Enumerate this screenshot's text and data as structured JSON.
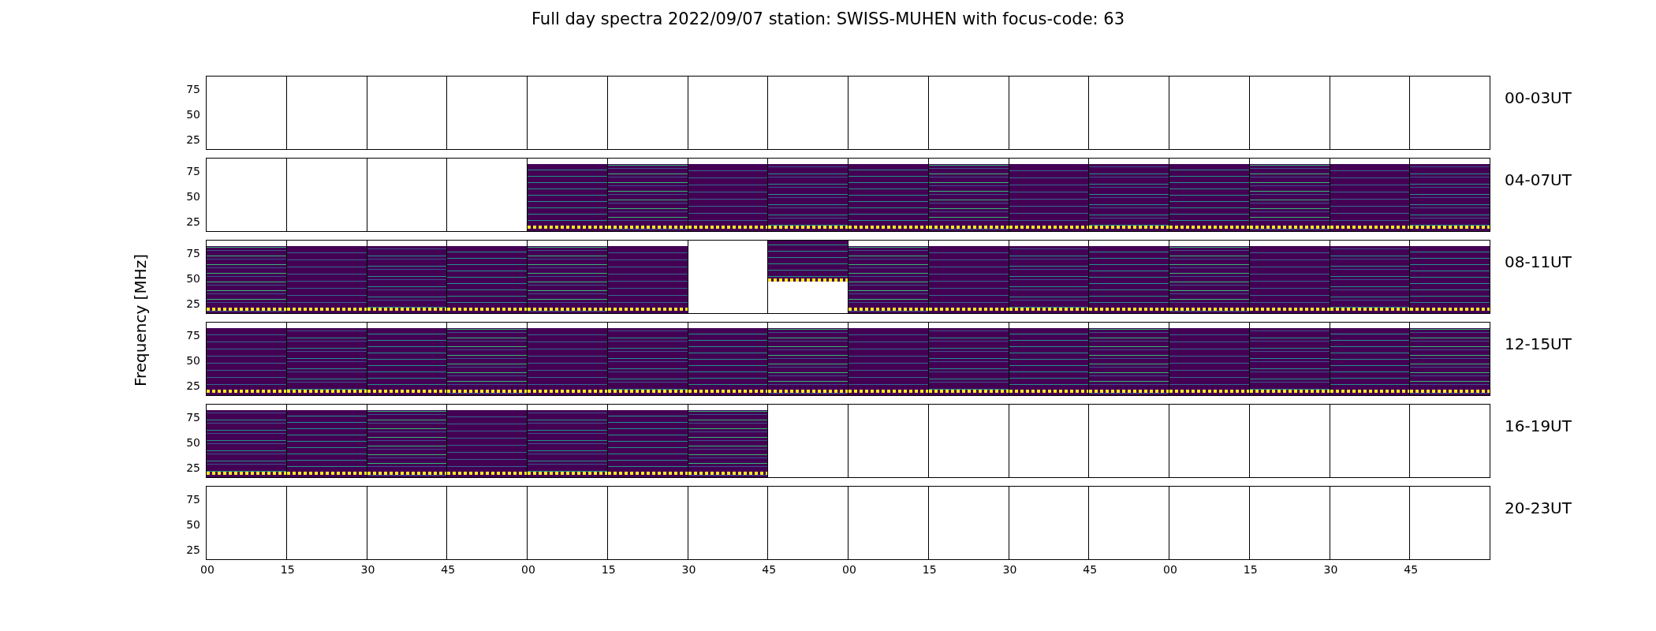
{
  "title": "Full day spectra 2022/09/07 station: SWISS-MUHEN with focus-code: 63",
  "ylabel": "Frequency [MHz]",
  "rows": [
    {
      "label": "00-03UT",
      "y_ticks": [
        "75",
        "50",
        "25"
      ],
      "panels": [
        {
          "kind": "empty"
        },
        {
          "kind": "empty"
        },
        {
          "kind": "empty"
        },
        {
          "kind": "empty"
        },
        {
          "kind": "empty"
        },
        {
          "kind": "empty"
        },
        {
          "kind": "empty"
        },
        {
          "kind": "empty"
        },
        {
          "kind": "empty"
        },
        {
          "kind": "empty"
        },
        {
          "kind": "empty"
        },
        {
          "kind": "empty"
        },
        {
          "kind": "empty"
        },
        {
          "kind": "empty"
        },
        {
          "kind": "empty"
        },
        {
          "kind": "empty"
        }
      ]
    },
    {
      "label": "04-07UT",
      "y_ticks": [
        "75",
        "50",
        "25"
      ],
      "panels": [
        {
          "kind": "empty"
        },
        {
          "kind": "empty"
        },
        {
          "kind": "empty"
        },
        {
          "kind": "empty"
        },
        {
          "kind": "full"
        },
        {
          "kind": "full"
        },
        {
          "kind": "full"
        },
        {
          "kind": "full"
        },
        {
          "kind": "full"
        },
        {
          "kind": "full"
        },
        {
          "kind": "full"
        },
        {
          "kind": "full"
        },
        {
          "kind": "full"
        },
        {
          "kind": "full"
        },
        {
          "kind": "full"
        },
        {
          "kind": "full"
        }
      ]
    },
    {
      "label": "08-11UT",
      "y_ticks": [
        "75",
        "50",
        "25"
      ],
      "panels": [
        {
          "kind": "full"
        },
        {
          "kind": "full"
        },
        {
          "kind": "full"
        },
        {
          "kind": "full"
        },
        {
          "kind": "full"
        },
        {
          "kind": "full"
        },
        {
          "kind": "empty"
        },
        {
          "kind": "partial"
        },
        {
          "kind": "full"
        },
        {
          "kind": "full"
        },
        {
          "kind": "full"
        },
        {
          "kind": "full"
        },
        {
          "kind": "full"
        },
        {
          "kind": "full"
        },
        {
          "kind": "full"
        },
        {
          "kind": "full"
        }
      ]
    },
    {
      "label": "12-15UT",
      "y_ticks": [
        "75",
        "50",
        "25"
      ],
      "panels": [
        {
          "kind": "full"
        },
        {
          "kind": "full"
        },
        {
          "kind": "full"
        },
        {
          "kind": "full"
        },
        {
          "kind": "full"
        },
        {
          "kind": "full"
        },
        {
          "kind": "full"
        },
        {
          "kind": "full"
        },
        {
          "kind": "full"
        },
        {
          "kind": "full"
        },
        {
          "kind": "full"
        },
        {
          "kind": "full"
        },
        {
          "kind": "full"
        },
        {
          "kind": "full"
        },
        {
          "kind": "full"
        },
        {
          "kind": "full"
        }
      ]
    },
    {
      "label": "16-19UT",
      "y_ticks": [
        "75",
        "50",
        "25"
      ],
      "panels": [
        {
          "kind": "full"
        },
        {
          "kind": "full"
        },
        {
          "kind": "full"
        },
        {
          "kind": "full"
        },
        {
          "kind": "full"
        },
        {
          "kind": "full"
        },
        {
          "kind": "full"
        },
        {
          "kind": "empty"
        },
        {
          "kind": "empty"
        },
        {
          "kind": "empty"
        },
        {
          "kind": "empty"
        },
        {
          "kind": "empty"
        },
        {
          "kind": "empty"
        },
        {
          "kind": "empty"
        },
        {
          "kind": "empty"
        },
        {
          "kind": "empty"
        }
      ]
    },
    {
      "label": "20-23UT",
      "y_ticks": [
        "75",
        "50",
        "25"
      ],
      "panels": [
        {
          "kind": "empty"
        },
        {
          "kind": "empty"
        },
        {
          "kind": "empty"
        },
        {
          "kind": "empty"
        },
        {
          "kind": "empty"
        },
        {
          "kind": "empty"
        },
        {
          "kind": "empty"
        },
        {
          "kind": "empty"
        },
        {
          "kind": "empty"
        },
        {
          "kind": "empty"
        },
        {
          "kind": "empty"
        },
        {
          "kind": "empty"
        },
        {
          "kind": "empty"
        },
        {
          "kind": "empty"
        },
        {
          "kind": "empty"
        },
        {
          "kind": "empty"
        }
      ]
    }
  ],
  "x_ticks": [
    "00",
    "15",
    "30",
    "45",
    "00",
    "15",
    "30",
    "45",
    "00",
    "15",
    "30",
    "45",
    "00",
    "15",
    "30",
    "45"
  ]
}
